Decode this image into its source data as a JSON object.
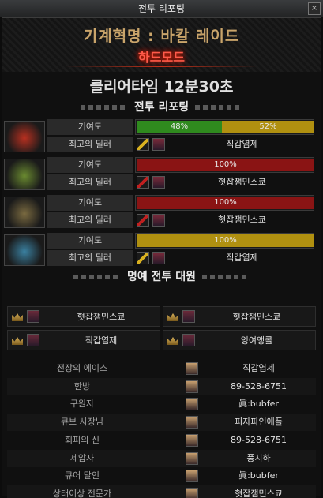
{
  "window": {
    "title": "전투 리포팅",
    "close_label": "×"
  },
  "banner": {
    "raid_title": "기계혁명 : 바칼 레이드",
    "difficulty": "하드모드"
  },
  "clear_time": "클리어타임 12분30초",
  "battle_section": {
    "title": "전투 리포팅"
  },
  "bosses": [
    {
      "contribution_label": "기여도",
      "dealer_label": "최고의 딜러",
      "segments": [
        {
          "label": "48%",
          "value": 48,
          "color": "#2f8a1e"
        },
        {
          "label": "52%",
          "value": 52,
          "color": "#b09010"
        }
      ],
      "top_dealer": "직갑염제",
      "weapon_color": "#d8b020",
      "portrait_color": "#b83020"
    },
    {
      "contribution_label": "기여도",
      "dealer_label": "최고의 딜러",
      "segments": [
        {
          "label": "100%",
          "value": 100,
          "color": "#8a1414"
        }
      ],
      "top_dealer": "혓잡잼민스쿄",
      "weapon_color": "#c02020",
      "portrait_color": "#6a8a30"
    },
    {
      "contribution_label": "기여도",
      "dealer_label": "최고의 딜러",
      "segments": [
        {
          "label": "100%",
          "value": 100,
          "color": "#8a1414"
        }
      ],
      "top_dealer": "혓잡잼민스쿄",
      "weapon_color": "#c02020",
      "portrait_color": "#7a6a40"
    },
    {
      "contribution_label": "기여도",
      "dealer_label": "최고의 딜러",
      "segments": [
        {
          "label": "100%",
          "value": 100,
          "color": "#b09010"
        }
      ],
      "top_dealer": "직갑염제",
      "weapon_color": "#d8b020",
      "portrait_color": "#3a80a0"
    }
  ],
  "honor_section": {
    "title": "명예 전투 대원",
    "members": [
      "혓잡잼민스쿄",
      "혓잡잼민스쿄",
      "직갑염제",
      "잉여앵콜"
    ]
  },
  "awards": [
    {
      "title": "전장의 에이스",
      "name": "직갑염제"
    },
    {
      "title": "한방",
      "name": "89-528-6751"
    },
    {
      "title": "구원자",
      "name": "眞:bubfer"
    },
    {
      "title": "큐브 사장님",
      "name": "피자파인애플"
    },
    {
      "title": "회피의 신",
      "name": "89-528-6751"
    },
    {
      "title": "제압자",
      "name": "풍시하"
    },
    {
      "title": "큐어 달인",
      "name": "眞:bubfer"
    },
    {
      "title": "상태이상 전문가",
      "name": "혓잡잼민스쿄"
    }
  ]
}
